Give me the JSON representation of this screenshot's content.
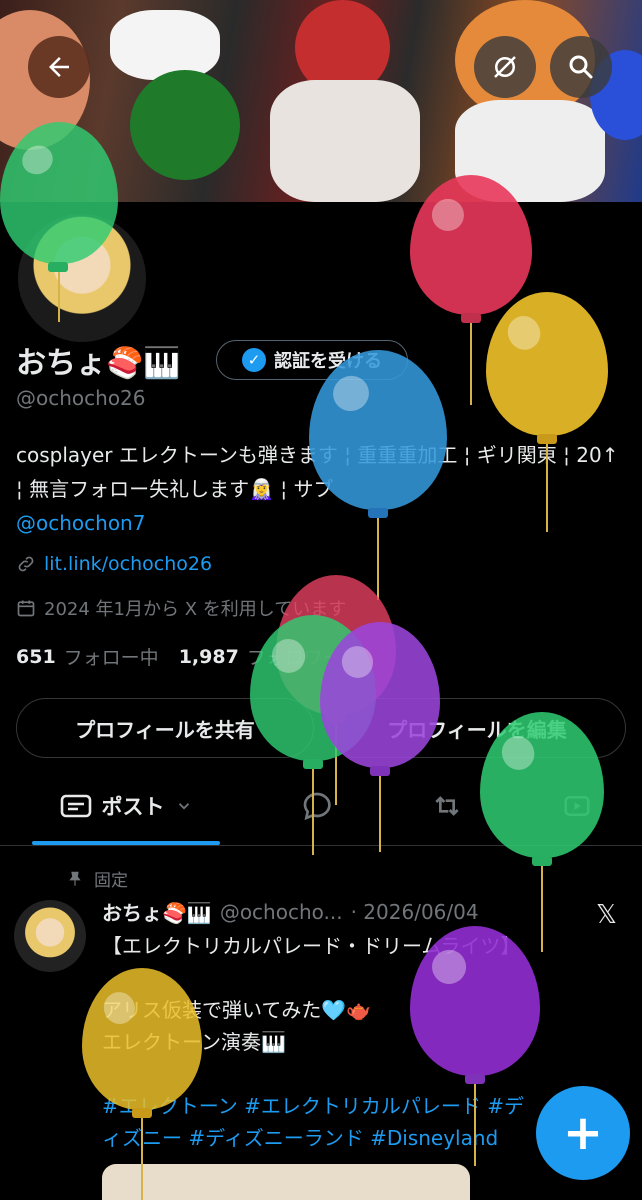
{
  "header": {
    "back_icon": "arrow-left-icon",
    "grok_icon": "grok-icon",
    "search_icon": "search-icon"
  },
  "profile": {
    "name": "おちょ🍣🎹",
    "verify_label": "認証を受ける",
    "handle": "@ochocho26",
    "bio_text": "cosplayer エレクトーンも弾きます ¦ 重重重加工 ¦ ギリ関東 ¦ 20↑ ¦ 無言フォロー失礼します🧝‍♀️ ¦ サブ",
    "bio_mention": "@ochochon7",
    "link": "lit.link/ochocho26",
    "joined": "2024 年1月から X を利用しています",
    "following_count": "651",
    "following_label": "フォロー中",
    "followers_count": "1,987",
    "followers_label": "フォロワー",
    "share_button": "プロフィールを共有",
    "edit_button": "プロフィールを編集"
  },
  "tabs": {
    "posts_label": "ポスト"
  },
  "post": {
    "pinned_label": "固定",
    "author_name": "おちょ🍣🎹",
    "author_handle": "@ochocho...",
    "date": "· 2026/06/04",
    "line1": "【エレクトリカルパレード・ドリームライツ】",
    "line2": "アリス仮装で弾いてみた🩵🫖",
    "line3": "エレクトーン演奏🎹",
    "hashtags": "#エレクトーン #エレクトリカルパレード #ディズニー #ディズニーランド #Disneyland"
  },
  "fab": {
    "label": "+"
  },
  "colors": {
    "accent": "#1d9bf0",
    "background": "#000000",
    "muted": "#71767b"
  }
}
